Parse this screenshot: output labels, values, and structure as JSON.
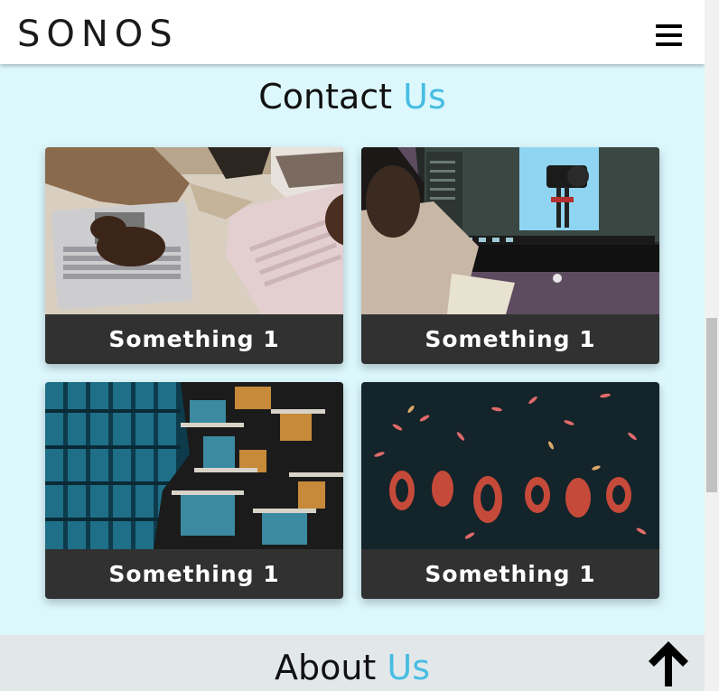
{
  "header": {
    "logo": "SONOS"
  },
  "contact": {
    "title_main": "Contact",
    "title_accent": "Us",
    "cards": [
      {
        "label": "Something 1",
        "image": "laptops-photo"
      },
      {
        "label": "Something 1",
        "image": "camera-monitor-photo"
      },
      {
        "label": "Something 1",
        "image": "building-photo"
      },
      {
        "label": "Something 1",
        "image": "organic-leaves-photo"
      }
    ]
  },
  "about": {
    "title_main": "About",
    "title_accent": "Us"
  },
  "colors": {
    "accent": "#47bde2",
    "contact_bg": "#dcf8fd",
    "about_bg": "#e2e8ea",
    "caption_bg": "#313131"
  }
}
